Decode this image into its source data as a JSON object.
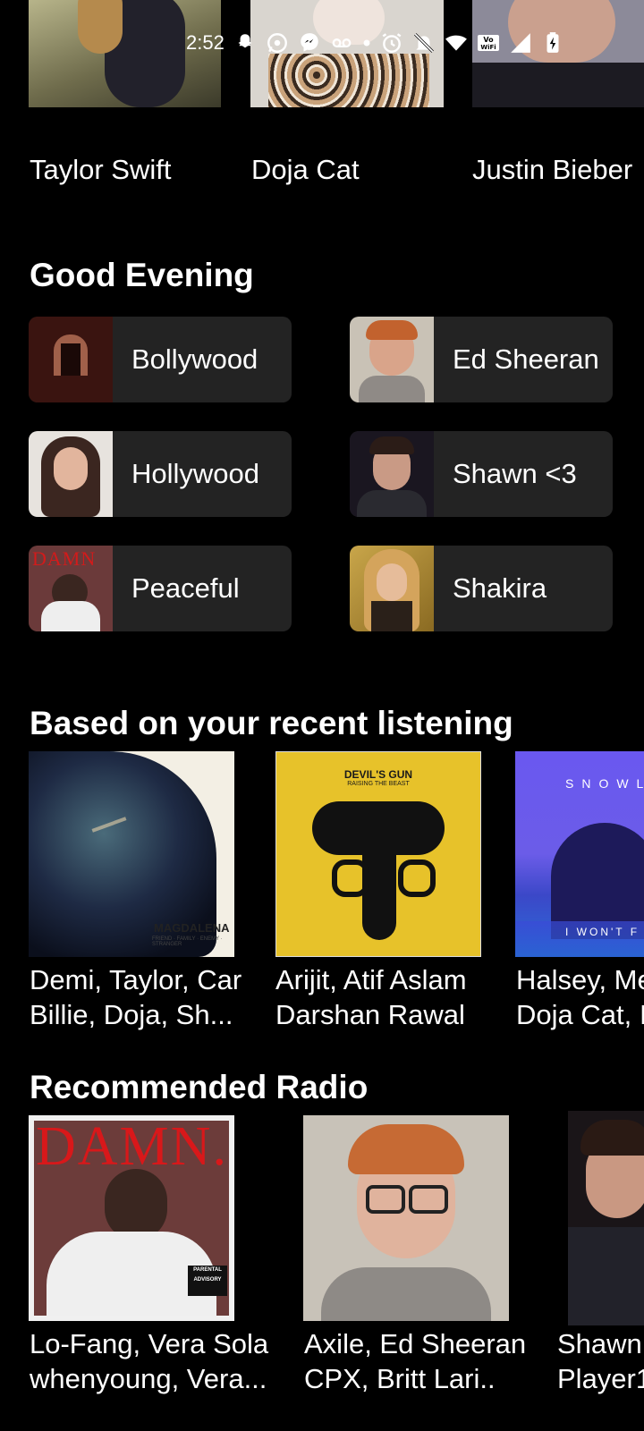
{
  "status_bar": {
    "time": "2:52",
    "icons": [
      "snapchat-icon",
      "whatsapp-icon",
      "messenger-icon",
      "voicemail-icon",
      "dot-icon",
      "alarm-icon",
      "notifications-off-icon",
      "wifi-icon",
      "vowifi-icon",
      "cell-signal-icon",
      "battery-charging-icon"
    ]
  },
  "artists": [
    {
      "name": "Taylor Swift"
    },
    {
      "name": "Doja Cat"
    },
    {
      "name": "Justin Bieber"
    }
  ],
  "good_evening": {
    "title": "Good Evening",
    "tiles": [
      {
        "label": "Bollywood"
      },
      {
        "label": "Ed Sheeran"
      },
      {
        "label": "Hollywood"
      },
      {
        "label": "Shawn <3"
      },
      {
        "label": "Peaceful"
      },
      {
        "label": "Shakira"
      }
    ]
  },
  "recent": {
    "title": "Based on your recent listening",
    "cards": [
      {
        "line1": "Demi, Taylor, Car",
        "line2": "Billie, Doja, Sh...",
        "cover_title": "MAGDALENA",
        "cover_sub": "FRIEND · FAMILY · ENEMY · STRANGER"
      },
      {
        "line1": "Arijit, Atif Aslam",
        "line2": "Darshan Rawal",
        "cover_title": "DEVIL'S GUN",
        "cover_sub": "RAISING THE BEAST"
      },
      {
        "line1": "Halsey, Me",
        "line2": "Doja Cat, I",
        "cover_title": "SNOWL",
        "cover_sub": "I WON'T F"
      }
    ]
  },
  "radio": {
    "title": "Recommended Radio",
    "cards": [
      {
        "line1": "Lo-Fang, Vera Sola",
        "line2": "whenyoung, Vera...",
        "cover_title": "DAMN.",
        "cover_badge": "PARENTAL ADVISORY"
      },
      {
        "line1": "Axile, Ed Sheeran",
        "line2": "CPX, Britt Lari.."
      },
      {
        "line1": "Shawn",
        "line2": "Player1"
      }
    ]
  },
  "colors": {
    "background": "#000000",
    "tile": "#232323",
    "text": "#ffffff"
  }
}
